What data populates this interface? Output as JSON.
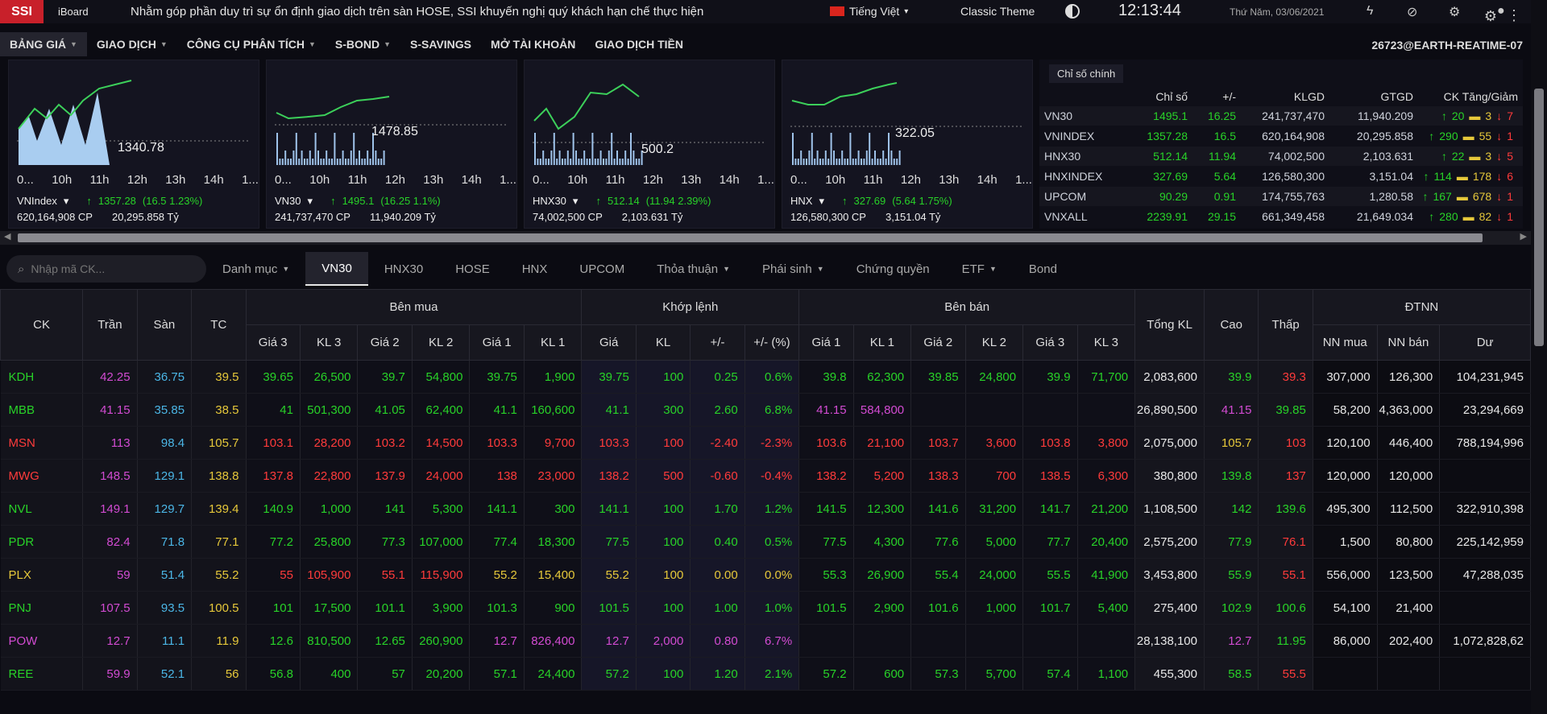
{
  "topbar": {
    "logo": "SSI",
    "brand": "iBoard",
    "news": "Nhằm góp phần duy trì sự ổn định giao dịch trên sàn HOSE, SSI khuyến nghị quý khách hạn chế thực hiện",
    "language": "Tiếng Việt",
    "theme": "Classic Theme",
    "clock": "12:13:44",
    "date": "Thứ Năm, 03/06/2021"
  },
  "nav": {
    "items": [
      {
        "label": "BẢNG GIÁ",
        "caret": true
      },
      {
        "label": "GIAO DỊCH",
        "caret": true
      },
      {
        "label": "CÔNG CỤ PHÂN TÍCH",
        "caret": true
      },
      {
        "label": "S-BOND",
        "caret": true
      },
      {
        "label": "S-SAVINGS",
        "caret": false
      },
      {
        "label": "MỞ TÀI KHOẢN",
        "caret": false
      },
      {
        "label": "GIAO DỊCH TIỀN",
        "caret": false
      }
    ],
    "account": "26723@EARTH-REATIME-07"
  },
  "mini_charts": [
    {
      "name": "VNIndex",
      "value": "1340.78",
      "change": "1357.28",
      "pct": "(16.5 1.23%)",
      "volume": "620,164,908 CP",
      "turnover": "20,295.858 Tỷ",
      "ticks": [
        "0...",
        "10h",
        "11h",
        "12h",
        "13h",
        "14h",
        "1..."
      ]
    },
    {
      "name": "VN30",
      "value": "1478.85",
      "change": "1495.1",
      "pct": "(16.25 1.1%)",
      "volume": "241,737,470 CP",
      "turnover": "11,940.209 Tỷ",
      "ticks": [
        "0...",
        "10h",
        "11h",
        "12h",
        "13h",
        "14h",
        "1..."
      ]
    },
    {
      "name": "HNX30",
      "value": "500.2",
      "change": "512.14",
      "pct": "(11.94 2.39%)",
      "volume": "74,002,500 CP",
      "turnover": "2,103.631 Tỷ",
      "ticks": [
        "0...",
        "10h",
        "11h",
        "12h",
        "13h",
        "14h",
        "1..."
      ]
    },
    {
      "name": "HNX",
      "value": "322.05",
      "change": "327.69",
      "pct": "(5.64 1.75%)",
      "volume": "126,580,300 CP",
      "turnover": "3,151.04 Tỷ",
      "ticks": [
        "0...",
        "10h",
        "11h",
        "12h",
        "13h",
        "14h",
        "1..."
      ]
    }
  ],
  "index_table": {
    "tab": "Chỉ số chính",
    "headers": [
      "",
      "Chỉ số",
      "+/-",
      "KLGD",
      "GTGD",
      "CK Tăng/Giảm"
    ],
    "rows": [
      {
        "name": "VN30",
        "value": "1495.1",
        "chg": "16.25",
        "vol": "241,737,470",
        "val": "11,940.209",
        "up": "20",
        "ref": "3",
        "dn": "7"
      },
      {
        "name": "VNINDEX",
        "value": "1357.28",
        "chg": "16.5",
        "vol": "620,164,908",
        "val": "20,295.858",
        "up": "290",
        "ref": "55",
        "dn": "1"
      },
      {
        "name": "HNX30",
        "value": "512.14",
        "chg": "11.94",
        "vol": "74,002,500",
        "val": "2,103.631",
        "up": "22",
        "ref": "3",
        "dn": "5"
      },
      {
        "name": "HNXINDEX",
        "value": "327.69",
        "chg": "5.64",
        "vol": "126,580,300",
        "val": "3,151.04",
        "up": "114",
        "ref": "178",
        "dn": "6"
      },
      {
        "name": "UPCOM",
        "value": "90.29",
        "chg": "0.91",
        "vol": "174,755,763",
        "val": "1,280.58",
        "up": "167",
        "ref": "678",
        "dn": "1"
      },
      {
        "name": "VNXALL",
        "value": "2239.91",
        "chg": "29.15",
        "vol": "661,349,458",
        "val": "21,649.034",
        "up": "280",
        "ref": "82",
        "dn": "1"
      }
    ]
  },
  "search": {
    "placeholder": "Nhập mã CK..."
  },
  "tabs": [
    {
      "label": "Danh mục",
      "caret": true,
      "active": false
    },
    {
      "label": "VN30",
      "caret": false,
      "active": true
    },
    {
      "label": "HNX30",
      "caret": false,
      "active": false
    },
    {
      "label": "HOSE",
      "caret": false,
      "active": false
    },
    {
      "label": "HNX",
      "caret": false,
      "active": false
    },
    {
      "label": "UPCOM",
      "caret": false,
      "active": false
    },
    {
      "label": "Thỏa thuận",
      "caret": true,
      "active": false
    },
    {
      "label": "Phái sinh",
      "caret": true,
      "active": false
    },
    {
      "label": "Chứng quyền",
      "caret": false,
      "active": false
    },
    {
      "label": "ETF",
      "caret": true,
      "active": false
    },
    {
      "label": "Bond",
      "caret": false,
      "active": false
    }
  ],
  "board": {
    "group_headers": {
      "buy": "Bên mua",
      "match": "Khớp lệnh",
      "sell": "Bên bán",
      "foreign": "ĐTNN"
    },
    "headers": {
      "ck": "CK",
      "ceil": "Trần",
      "floor": "Sàn",
      "ref": "TC",
      "total": "Tổng KL",
      "high": "Cao",
      "low": "Thấp"
    },
    "sub_headers": [
      "Giá 3",
      "KL 3",
      "Giá 2",
      "KL 2",
      "Giá 1",
      "KL 1",
      "Giá",
      "KL",
      "+/-",
      "+/- (%)",
      "Giá 1",
      "KL 1",
      "Giá 2",
      "KL 2",
      "Giá 3",
      "KL 3",
      "NN mua",
      "NN bán",
      "Dư"
    ],
    "rows": [
      [
        "KDH",
        "42.25",
        "36.75",
        "39.5",
        "39.65",
        "26,500",
        "39.7",
        "54,800",
        "39.75",
        "1,900",
        "39.75",
        "100",
        "0.25",
        "0.6%",
        "39.8",
        "62,300",
        "39.85",
        "24,800",
        "39.9",
        "71,700",
        "2,083,600",
        "39.9",
        "39.3",
        "307,000",
        "126,300",
        "104,231,945"
      ],
      [
        "MBB",
        "41.15",
        "35.85",
        "38.5",
        "41",
        "501,300",
        "41.05",
        "62,400",
        "41.1",
        "160,600",
        "41.1",
        "300",
        "2.60",
        "6.8%",
        "41.15",
        "584,800",
        "",
        "",
        "",
        "",
        "26,890,500",
        "41.15",
        "39.85",
        "58,200",
        "4,363,000",
        "23,294,669"
      ],
      [
        "MSN",
        "113",
        "98.4",
        "105.7",
        "103.1",
        "28,200",
        "103.2",
        "14,500",
        "103.3",
        "9,700",
        "103.3",
        "100",
        "-2.40",
        "-2.3%",
        "103.6",
        "21,100",
        "103.7",
        "3,600",
        "103.8",
        "3,800",
        "2,075,000",
        "105.7",
        "103",
        "120,100",
        "446,400",
        "788,194,996"
      ],
      [
        "MWG",
        "148.5",
        "129.1",
        "138.8",
        "137.8",
        "22,800",
        "137.9",
        "24,000",
        "138",
        "23,000",
        "138.2",
        "500",
        "-0.60",
        "-0.4%",
        "138.2",
        "5,200",
        "138.3",
        "700",
        "138.5",
        "6,300",
        "380,800",
        "139.8",
        "137",
        "120,000",
        "120,000",
        ""
      ],
      [
        "NVL",
        "149.1",
        "129.7",
        "139.4",
        "140.9",
        "1,000",
        "141",
        "5,300",
        "141.1",
        "300",
        "141.1",
        "100",
        "1.70",
        "1.2%",
        "141.5",
        "12,300",
        "141.6",
        "31,200",
        "141.7",
        "21,200",
        "1,108,500",
        "142",
        "139.6",
        "495,300",
        "112,500",
        "322,910,398"
      ],
      [
        "PDR",
        "82.4",
        "71.8",
        "77.1",
        "77.2",
        "25,800",
        "77.3",
        "107,000",
        "77.4",
        "18,300",
        "77.5",
        "100",
        "0.40",
        "0.5%",
        "77.5",
        "4,300",
        "77.6",
        "5,000",
        "77.7",
        "20,400",
        "2,575,200",
        "77.9",
        "76.1",
        "1,500",
        "80,800",
        "225,142,959"
      ],
      [
        "PLX",
        "59",
        "51.4",
        "55.2",
        "55",
        "105,900",
        "55.1",
        "115,900",
        "55.2",
        "15,400",
        "55.2",
        "100",
        "0.00",
        "0.0%",
        "55.3",
        "26,900",
        "55.4",
        "24,000",
        "55.5",
        "41,900",
        "3,453,800",
        "55.9",
        "55.1",
        "556,000",
        "123,500",
        "47,288,035"
      ],
      [
        "PNJ",
        "107.5",
        "93.5",
        "100.5",
        "101",
        "17,500",
        "101.1",
        "3,900",
        "101.3",
        "900",
        "101.5",
        "100",
        "1.00",
        "1.0%",
        "101.5",
        "2,900",
        "101.6",
        "1,000",
        "101.7",
        "5,400",
        "275,400",
        "102.9",
        "100.6",
        "54,100",
        "21,400",
        ""
      ],
      [
        "POW",
        "12.7",
        "11.1",
        "11.9",
        "12.6",
        "810,500",
        "12.65",
        "260,900",
        "12.7",
        "826,400",
        "12.7",
        "2,000",
        "0.80",
        "6.7%",
        "",
        "",
        "",
        "",
        "",
        "",
        "28,138,100",
        "12.7",
        "11.95",
        "86,000",
        "202,400",
        "1,072,828,62"
      ],
      [
        "REE",
        "59.9",
        "52.1",
        "56",
        "56.8",
        "400",
        "57",
        "20,200",
        "57.1",
        "24,400",
        "57.2",
        "100",
        "1.20",
        "2.1%",
        "57.2",
        "600",
        "57.3",
        "5,700",
        "57.4",
        "1,100",
        "455,300",
        "58.5",
        "55.5",
        "",
        "",
        ""
      ]
    ],
    "colors": [
      [
        "up",
        "ceil",
        "floor",
        "ref",
        "up",
        "up",
        "up",
        "up",
        "up",
        "up",
        "up",
        "up",
        "up",
        "up",
        "up",
        "up",
        "up",
        "up",
        "up",
        "up",
        "w",
        "up",
        "dn",
        "w",
        "w",
        "w"
      ],
      [
        "up",
        "ceil",
        "floor",
        "ref",
        "up",
        "up",
        "up",
        "up",
        "up",
        "up",
        "up",
        "up",
        "up",
        "up",
        "ceil",
        "ceil",
        "w",
        "w",
        "w",
        "w",
        "w",
        "ceil",
        "up",
        "w",
        "w",
        "w"
      ],
      [
        "dn",
        "ceil",
        "floor",
        "ref",
        "dn",
        "dn",
        "dn",
        "dn",
        "dn",
        "dn",
        "dn",
        "dn",
        "dn",
        "dn",
        "dn",
        "dn",
        "dn",
        "dn",
        "dn",
        "dn",
        "w",
        "ref",
        "dn",
        "w",
        "w",
        "w"
      ],
      [
        "dn",
        "ceil",
        "floor",
        "ref",
        "dn",
        "dn",
        "dn",
        "dn",
        "dn",
        "dn",
        "dn",
        "dn",
        "dn",
        "dn",
        "dn",
        "dn",
        "dn",
        "dn",
        "dn",
        "dn",
        "w",
        "up",
        "dn",
        "w",
        "w",
        "w"
      ],
      [
        "up",
        "ceil",
        "floor",
        "ref",
        "up",
        "up",
        "up",
        "up",
        "up",
        "up",
        "up",
        "up",
        "up",
        "up",
        "up",
        "up",
        "up",
        "up",
        "up",
        "up",
        "w",
        "up",
        "up",
        "w",
        "w",
        "w"
      ],
      [
        "up",
        "ceil",
        "floor",
        "ref",
        "up",
        "up",
        "up",
        "up",
        "up",
        "up",
        "up",
        "up",
        "up",
        "up",
        "up",
        "up",
        "up",
        "up",
        "up",
        "up",
        "w",
        "up",
        "dn",
        "w",
        "w",
        "w"
      ],
      [
        "ref",
        "ceil",
        "floor",
        "ref",
        "dn",
        "dn",
        "dn",
        "dn",
        "ref",
        "ref",
        "ref",
        "ref",
        "ref",
        "ref",
        "up",
        "up",
        "up",
        "up",
        "up",
        "up",
        "w",
        "up",
        "dn",
        "w",
        "w",
        "w"
      ],
      [
        "up",
        "ceil",
        "floor",
        "ref",
        "up",
        "up",
        "up",
        "up",
        "up",
        "up",
        "up",
        "up",
        "up",
        "up",
        "up",
        "up",
        "up",
        "up",
        "up",
        "up",
        "w",
        "up",
        "up",
        "w",
        "w",
        "w"
      ],
      [
        "ceil",
        "ceil",
        "floor",
        "ref",
        "up",
        "up",
        "up",
        "up",
        "ceil",
        "ceil",
        "ceil",
        "ceil",
        "ceil",
        "ceil",
        "w",
        "w",
        "w",
        "w",
        "w",
        "w",
        "w",
        "ceil",
        "up",
        "w",
        "w",
        "w"
      ],
      [
        "up",
        "ceil",
        "floor",
        "ref",
        "up",
        "up",
        "up",
        "up",
        "up",
        "up",
        "up",
        "up",
        "up",
        "up",
        "up",
        "up",
        "up",
        "up",
        "up",
        "up",
        "w",
        "up",
        "dn",
        "w",
        "w",
        "w"
      ]
    ]
  }
}
